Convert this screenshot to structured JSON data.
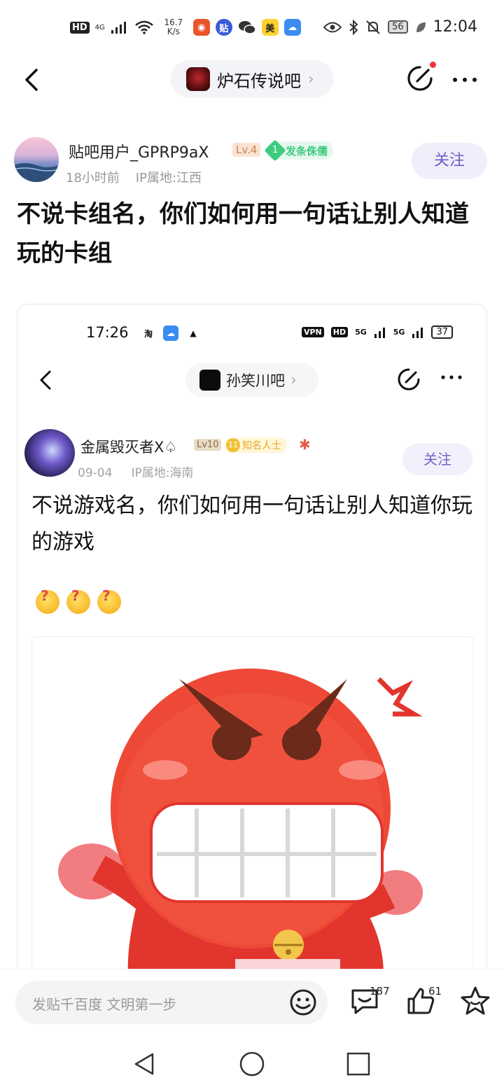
{
  "status_bar": {
    "hd": "HD",
    "net": "4G",
    "speed_value": "16.7",
    "speed_unit": "K/s",
    "meituan": "美",
    "battery": "56",
    "time": "12:04"
  },
  "nav": {
    "forum_name": "炉石传说吧"
  },
  "post": {
    "username": "贴吧用户_GPRP9aX",
    "level": "Lv.4",
    "badge_num": "1",
    "badge_text": "发条侏儒",
    "time": "18小时前",
    "ip": "IP属地:江西",
    "follow_label": "关注",
    "title": "不说卡组名，你们如何用一句话让别人知道玩的卡组"
  },
  "embedded": {
    "time": "17:26",
    "taobao": "淘",
    "vpn": "VPN",
    "hd": "HD",
    "net1": "5G",
    "net2": "5G",
    "battery": "37",
    "forum_name": "孙笑川吧",
    "username": "金属毁灭者X♤",
    "level": "Lv10",
    "badge_num": "11",
    "badge_text": "知名人士",
    "date": "09-04",
    "ip": "IP属地:海南",
    "follow_label": "关注",
    "title": "不说游戏名，你们如何用一句话让别人知道你玩的游戏"
  },
  "bottom_bar": {
    "placeholder": "发贴千百度 文明第一步",
    "comment_count": "187",
    "like_count": "61"
  },
  "icons": {
    "back": "chevron-left-icon",
    "share": "share-icon",
    "more": "more-icon",
    "emoji": "emoji-icon",
    "comment": "comment-icon",
    "like": "thumb-up-icon",
    "favorite": "star-icon"
  },
  "colors": {
    "accent": "#6b5fc9",
    "follow_bg": "#f1eefb",
    "badge_green": "#3ccc7e",
    "notify_red": "#f2323b"
  }
}
